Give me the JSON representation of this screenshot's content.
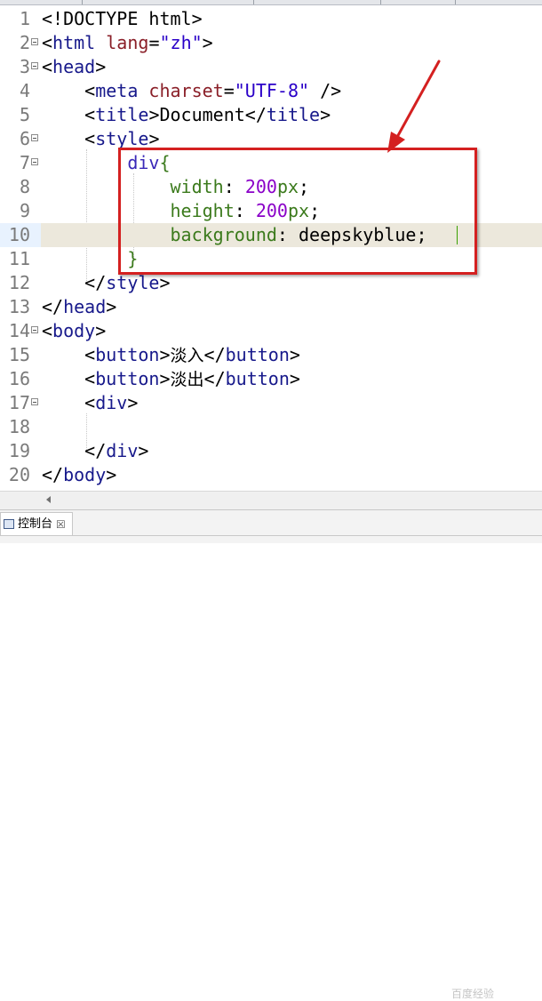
{
  "editor": {
    "current_line": 10,
    "lines": [
      {
        "num": "1",
        "fold": false,
        "segs": [
          {
            "t": "<!DOCTYPE html>",
            "c": ""
          }
        ]
      },
      {
        "num": "2",
        "fold": true,
        "segs": [
          {
            "t": "<",
            "c": ""
          },
          {
            "t": "html",
            "c": "tag"
          },
          {
            "t": " lang",
            "c": "attr"
          },
          {
            "t": "=",
            "c": ""
          },
          {
            "t": "\"zh\"",
            "c": "str"
          },
          {
            "t": ">",
            "c": ""
          }
        ]
      },
      {
        "num": "3",
        "fold": true,
        "segs": [
          {
            "t": "<",
            "c": ""
          },
          {
            "t": "head",
            "c": "tag"
          },
          {
            "t": ">",
            "c": ""
          }
        ]
      },
      {
        "num": "4",
        "fold": false,
        "segs": [
          {
            "t": "    <",
            "c": ""
          },
          {
            "t": "meta",
            "c": "tag"
          },
          {
            "t": " charset",
            "c": "attr"
          },
          {
            "t": "=",
            "c": ""
          },
          {
            "t": "\"UTF-8\"",
            "c": "str"
          },
          {
            "t": " />",
            "c": ""
          }
        ]
      },
      {
        "num": "5",
        "fold": false,
        "segs": [
          {
            "t": "    <",
            "c": ""
          },
          {
            "t": "title",
            "c": "tag"
          },
          {
            "t": ">Document</",
            "c": ""
          },
          {
            "t": "title",
            "c": "tag"
          },
          {
            "t": ">",
            "c": ""
          }
        ]
      },
      {
        "num": "6",
        "fold": true,
        "segs": [
          {
            "t": "    <",
            "c": ""
          },
          {
            "t": "style",
            "c": "tag"
          },
          {
            "t": ">",
            "c": ""
          }
        ]
      },
      {
        "num": "7",
        "fold": true,
        "segs": [
          {
            "t": "        ",
            "c": ""
          },
          {
            "t": "div",
            "c": "sel"
          },
          {
            "t": "{",
            "c": "prop"
          }
        ]
      },
      {
        "num": "8",
        "fold": false,
        "segs": [
          {
            "t": "            ",
            "c": ""
          },
          {
            "t": "width",
            "c": "prop"
          },
          {
            "t": ": ",
            "c": ""
          },
          {
            "t": "200",
            "c": "num"
          },
          {
            "t": "px",
            "c": "prop"
          },
          {
            "t": ";",
            "c": ""
          }
        ]
      },
      {
        "num": "9",
        "fold": false,
        "segs": [
          {
            "t": "            ",
            "c": ""
          },
          {
            "t": "height",
            "c": "prop"
          },
          {
            "t": ": ",
            "c": ""
          },
          {
            "t": "200",
            "c": "num"
          },
          {
            "t": "px",
            "c": "prop"
          },
          {
            "t": ";",
            "c": ""
          }
        ]
      },
      {
        "num": "10",
        "fold": false,
        "segs": [
          {
            "t": "            ",
            "c": ""
          },
          {
            "t": "background",
            "c": "prop"
          },
          {
            "t": ": deepskyblue;",
            "c": ""
          }
        ]
      },
      {
        "num": "11",
        "fold": false,
        "segs": [
          {
            "t": "        ",
            "c": ""
          },
          {
            "t": "}",
            "c": "prop"
          }
        ]
      },
      {
        "num": "12",
        "fold": false,
        "segs": [
          {
            "t": "    </",
            "c": ""
          },
          {
            "t": "style",
            "c": "tag"
          },
          {
            "t": ">",
            "c": ""
          }
        ]
      },
      {
        "num": "13",
        "fold": false,
        "segs": [
          {
            "t": "</",
            "c": ""
          },
          {
            "t": "head",
            "c": "tag"
          },
          {
            "t": ">",
            "c": ""
          }
        ]
      },
      {
        "num": "14",
        "fold": true,
        "segs": [
          {
            "t": "<",
            "c": ""
          },
          {
            "t": "body",
            "c": "tag"
          },
          {
            "t": ">",
            "c": ""
          }
        ]
      },
      {
        "num": "15",
        "fold": false,
        "segs": [
          {
            "t": "    <",
            "c": ""
          },
          {
            "t": "button",
            "c": "tag"
          },
          {
            "t": ">",
            "c": ""
          },
          {
            "t": "淡入",
            "c": "cjk"
          },
          {
            "t": "</",
            "c": ""
          },
          {
            "t": "button",
            "c": "tag"
          },
          {
            "t": ">",
            "c": ""
          }
        ]
      },
      {
        "num": "16",
        "fold": false,
        "segs": [
          {
            "t": "    <",
            "c": ""
          },
          {
            "t": "button",
            "c": "tag"
          },
          {
            "t": ">",
            "c": ""
          },
          {
            "t": "淡出",
            "c": "cjk"
          },
          {
            "t": "</",
            "c": ""
          },
          {
            "t": "button",
            "c": "tag"
          },
          {
            "t": ">",
            "c": ""
          }
        ]
      },
      {
        "num": "17",
        "fold": true,
        "segs": [
          {
            "t": "    <",
            "c": ""
          },
          {
            "t": "div",
            "c": "tag"
          },
          {
            "t": ">",
            "c": ""
          }
        ]
      },
      {
        "num": "18",
        "fold": false,
        "segs": []
      },
      {
        "num": "19",
        "fold": false,
        "segs": [
          {
            "t": "    </",
            "c": ""
          },
          {
            "t": "div",
            "c": "tag"
          },
          {
            "t": ">",
            "c": ""
          }
        ]
      },
      {
        "num": "20",
        "fold": false,
        "segs": [
          {
            "t": "</",
            "c": ""
          },
          {
            "t": "body",
            "c": "tag"
          },
          {
            "t": ">",
            "c": ""
          }
        ]
      }
    ]
  },
  "panel": {
    "tab_label": "控制台",
    "tab_icon": "console-icon",
    "close_glyph": "☒"
  },
  "watermark": "百度经验",
  "annotation": {
    "box_color": "#d42020",
    "arrow_color": "#d42020"
  },
  "colors": {
    "tag": "#17198b",
    "attribute": "#8a1f28",
    "string": "#2a00c8",
    "property": "#3b7a1c",
    "number": "#8a00c8",
    "current_line": "#ece8dc"
  }
}
